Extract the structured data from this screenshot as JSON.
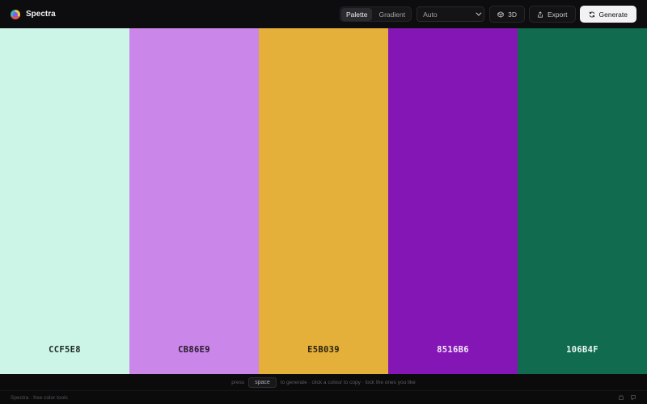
{
  "app": {
    "name": "Spectra"
  },
  "mode_toggle": {
    "options": [
      "Palette",
      "Gradient"
    ],
    "selected": "Palette"
  },
  "harmony_select": {
    "value": "Auto"
  },
  "toolbar": {
    "three_d_label": "3D",
    "export_label": "Export",
    "generate_label": "Generate"
  },
  "palette": [
    {
      "hex": "CCF5E8",
      "color": "#CCF5E8",
      "text_color": "#1f2a26"
    },
    {
      "hex": "CB86E9",
      "color": "#CB86E9",
      "text_color": "#241a2a"
    },
    {
      "hex": "E5B039",
      "color": "#E5B039",
      "text_color": "#2a220f"
    },
    {
      "hex": "8516B6",
      "color": "#8516B6",
      "text_color": "#f4eafa"
    },
    {
      "hex": "106B4F",
      "color": "#106B4F",
      "text_color": "#eaf6f1"
    }
  ],
  "hint": {
    "before": "press",
    "key": "space",
    "after": "to generate · click a colour to copy · lock the ones you like"
  },
  "footer": {
    "text": "Spectra · free color tools"
  },
  "icons": {
    "logo": "spectra-logo",
    "three_d": "cube-icon",
    "export": "share-icon",
    "generate": "refresh-icon",
    "footer_left": "github-icon",
    "footer_right": "feedback-icon"
  }
}
